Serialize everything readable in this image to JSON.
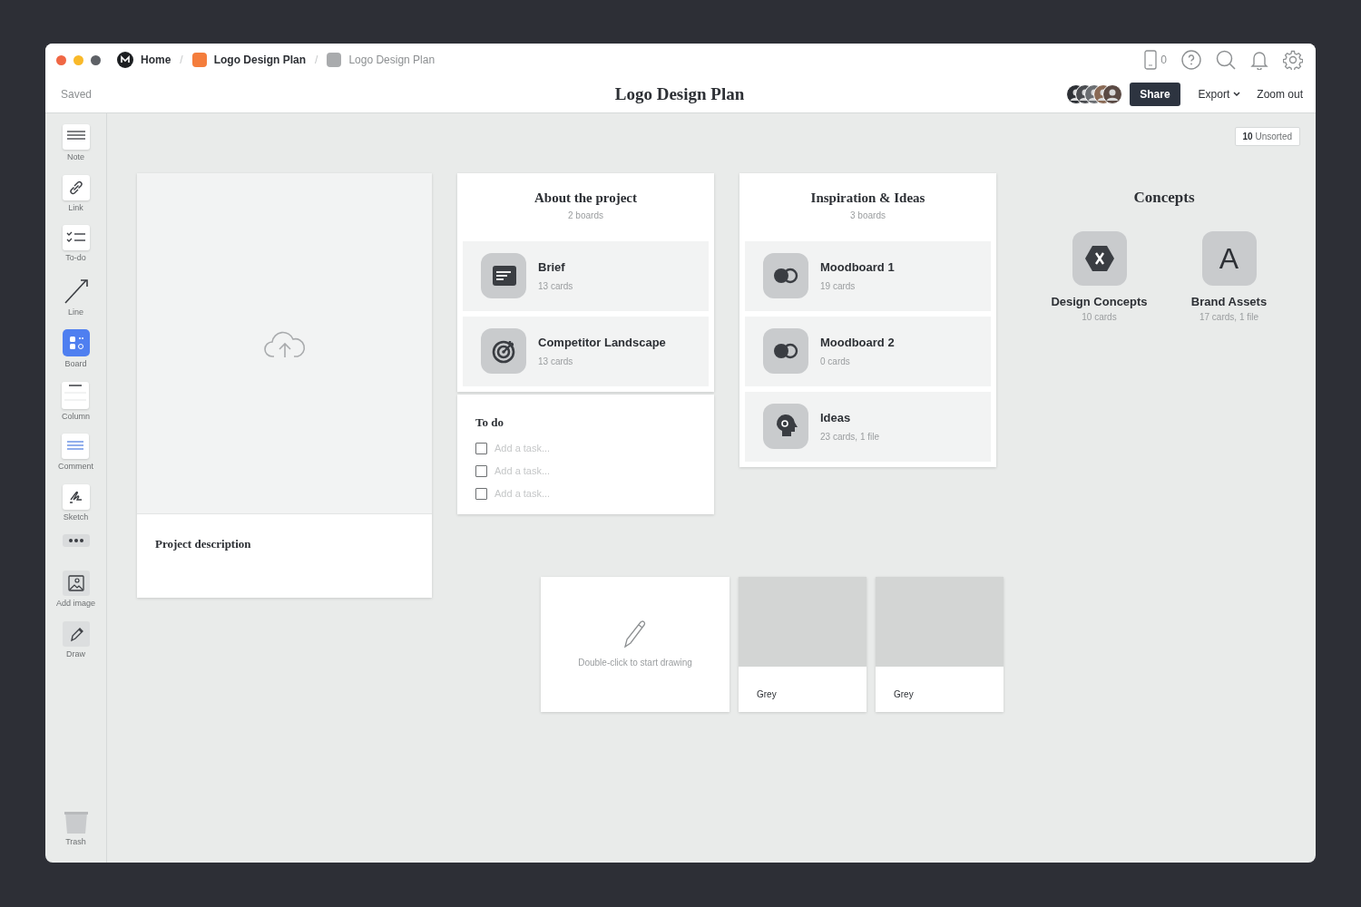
{
  "breadcrumbs": [
    {
      "kind": "home",
      "label": "Home",
      "current": false
    },
    {
      "kind": "board",
      "separator": "/",
      "label": "Logo Design Plan",
      "color": "#f47d3c",
      "current": false
    },
    {
      "kind": "board",
      "separator": "/",
      "label": "Logo Design Plan",
      "color": "#a9abad",
      "current": true
    }
  ],
  "save_status": "Saved",
  "title": "Logo Design Plan",
  "device_count": "0",
  "share": "Share",
  "export": "Export",
  "zoom_out": "Zoom out",
  "tools": [
    {
      "label": "Note"
    },
    {
      "label": "Link"
    },
    {
      "label": "To-do"
    },
    {
      "label": "Line"
    },
    {
      "label": "Board"
    },
    {
      "label": "Column"
    },
    {
      "label": "Comment"
    },
    {
      "label": "Sketch"
    },
    {
      "kind": "more"
    },
    {
      "label": "Add image"
    },
    {
      "label": "Draw"
    }
  ],
  "trash": "Trash",
  "unsorted": {
    "count": "10",
    "label": "Unsorted"
  },
  "cards": [
    {
      "kind": "image",
      "caption": "Project description"
    },
    {
      "kind": "column",
      "title": "About the project",
      "subtitle": "2 boards",
      "items": [
        {
          "title": "Brief",
          "subtitle": "13 cards"
        },
        {
          "title": "Competitor Landscape",
          "subtitle": "13 cards"
        }
      ]
    },
    {
      "kind": "todo",
      "title": "To do",
      "tasks": [
        {
          "placeholder": "Add a task...",
          "checked": false
        },
        {
          "placeholder": "Add a task...",
          "checked": false
        },
        {
          "placeholder": "Add a task...",
          "checked": false
        }
      ]
    },
    {
      "kind": "column",
      "title": "Inspiration & Ideas",
      "subtitle": "3 boards",
      "items": [
        {
          "title": "Moodboard 1",
          "subtitle": "19 cards"
        },
        {
          "title": "Moodboard 2",
          "subtitle": "0 cards"
        },
        {
          "title": "Ideas",
          "subtitle": "23 cards, 1 file"
        }
      ]
    },
    {
      "kind": "group",
      "title": "Concepts",
      "items": [
        {
          "title": "Design Concepts",
          "subtitle": "10 cards"
        },
        {
          "title": "Brand Assets",
          "subtitle": "17 cards, 1 file",
          "letter": "A"
        }
      ]
    },
    {
      "kind": "drawing",
      "hint": "Double-click to start drawing"
    },
    {
      "kind": "swatch",
      "label": "Grey",
      "color": "#d3d5d4"
    },
    {
      "kind": "swatch",
      "label": "Grey",
      "color": "#d3d5d4"
    }
  ]
}
